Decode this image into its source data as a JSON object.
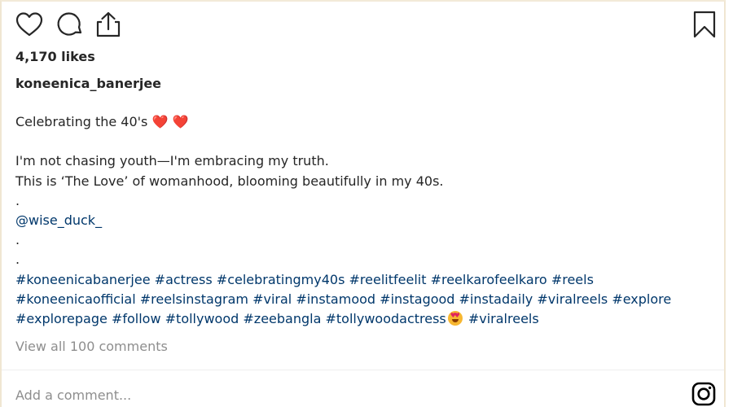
{
  "post": {
    "likes": "4,170 likes",
    "username": "koneenica_banerjee",
    "caption": {
      "line1": "Celebrating the 40's",
      "line1_emoji": "❤️ ❤️",
      "line3": "I'm not chasing youth—I'm embracing my truth.",
      "line4": "This is ‘The Love’ of womanhood, blooming beautifully in my 40s.",
      "dot": ".",
      "mention": "@wise_duck_",
      "hashtags_row1": [
        "#koneenicabanerjee",
        "#actress",
        "#celebratingmy40s",
        "#reelitfeelit",
        "#reelkarofeelkaro",
        "#reels"
      ],
      "hashtags_row2": [
        "#koneenicaofficial",
        "#reelsinstagram",
        "#viral",
        "#instamood",
        "#instagood",
        "#instadaily",
        "#viralreels",
        "#explore"
      ],
      "hashtags_row3": [
        "#explorepage",
        "#follow",
        "#tollywood",
        "#zeebangla",
        "#tollywoodactress",
        "#viralreels"
      ]
    },
    "view_comments": "View all 100 comments",
    "comment_placeholder": "Add a comment..."
  },
  "icons": {
    "like": "heart-outline-icon",
    "comment": "speech-bubble-icon",
    "share": "share-upload-icon",
    "save": "bookmark-icon",
    "brand": "instagram-logo-icon",
    "emoji": "heart-eyes-emoji"
  },
  "colors": {
    "text": "#262626",
    "link": "#00376b",
    "muted": "#8e8e8e",
    "heart": "#e0245e"
  }
}
